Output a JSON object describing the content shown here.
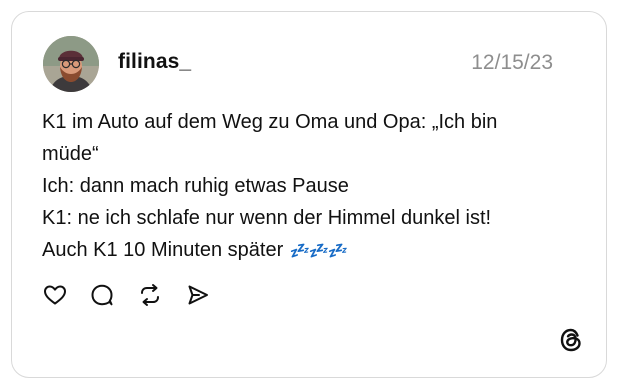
{
  "post": {
    "username": "filinas_",
    "date": "12/15/23",
    "lines": [
      "K1 im Auto auf dem Weg zu Oma und Opa: „Ich bin",
      "müde“",
      "Ich: dann mach ruhig etwas Pause",
      "K1: ne ich schlafe nur wenn der Himmel dunkel ist!",
      "Auch K1 10 Minuten später "
    ],
    "sleep_emojis": "💤💤💤"
  },
  "actions": {
    "icons": [
      "heart-icon",
      "comment-icon",
      "repost-icon",
      "share-icon"
    ]
  },
  "branding": {
    "logo_icon": "threads-logo-icon"
  },
  "colors": {
    "text": "#111111",
    "date": "#8e8e8e",
    "border": "#d9d9d9",
    "emoji": "#3a78c9"
  }
}
